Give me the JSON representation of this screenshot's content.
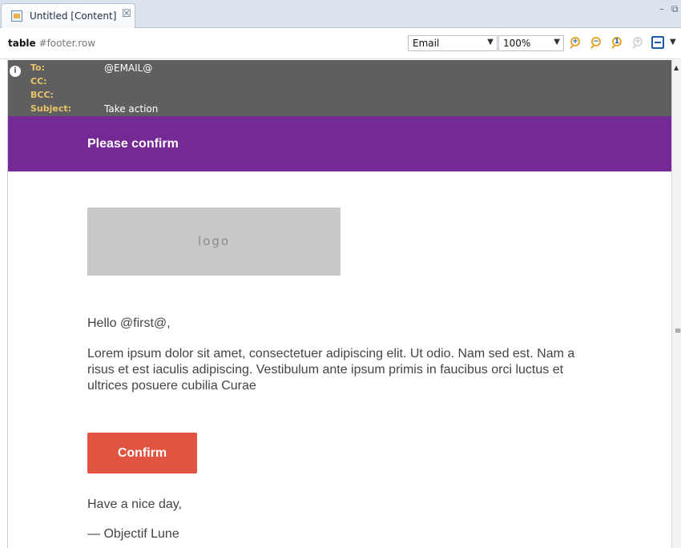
{
  "tab": {
    "label": "Untitled [Content]",
    "close": "☒"
  },
  "window_controls": {
    "minimize": "–",
    "restore": "⧉"
  },
  "toolbar": {
    "crumb_strong": "table",
    "crumb_light": "#footer.row",
    "view_select": "Email",
    "zoom_select": "100%",
    "select_arrow": "▼",
    "zoom_in_glyph": "+",
    "zoom_out_glyph": "−",
    "zoom_actual_glyph": "1",
    "zoom_fit_glyph": "+"
  },
  "email_header": {
    "info": "i",
    "to_label": "To:",
    "to_value": "@EMAIL@",
    "cc_label": "CC:",
    "bcc_label": "BCC:",
    "subject_label": "Subject:",
    "subject_value": "Take action"
  },
  "banner": {
    "title": "Please confirm"
  },
  "content": {
    "logo_text": "logo",
    "greeting": "Hello @first@,",
    "body": "Lorem ipsum dolor sit amet, consectetuer adipiscing elit. Ut odio. Nam sed est. Nam a risus et est iaculis adipiscing. Vestibulum ante ipsum primis in faucibus orci luctus et ultrices posuere cubilia Curae",
    "button_label": "Confirm",
    "closing": "Have a nice day,",
    "signature": "— Objectif Lune"
  },
  "scrollbar": {
    "up": "▲",
    "grip": "≡"
  },
  "colors": {
    "banner": "#742994",
    "header_bg": "#5f5f5f",
    "header_label": "#e9c46a",
    "button": "#e05441",
    "logo_bg": "#c8c8c8"
  }
}
